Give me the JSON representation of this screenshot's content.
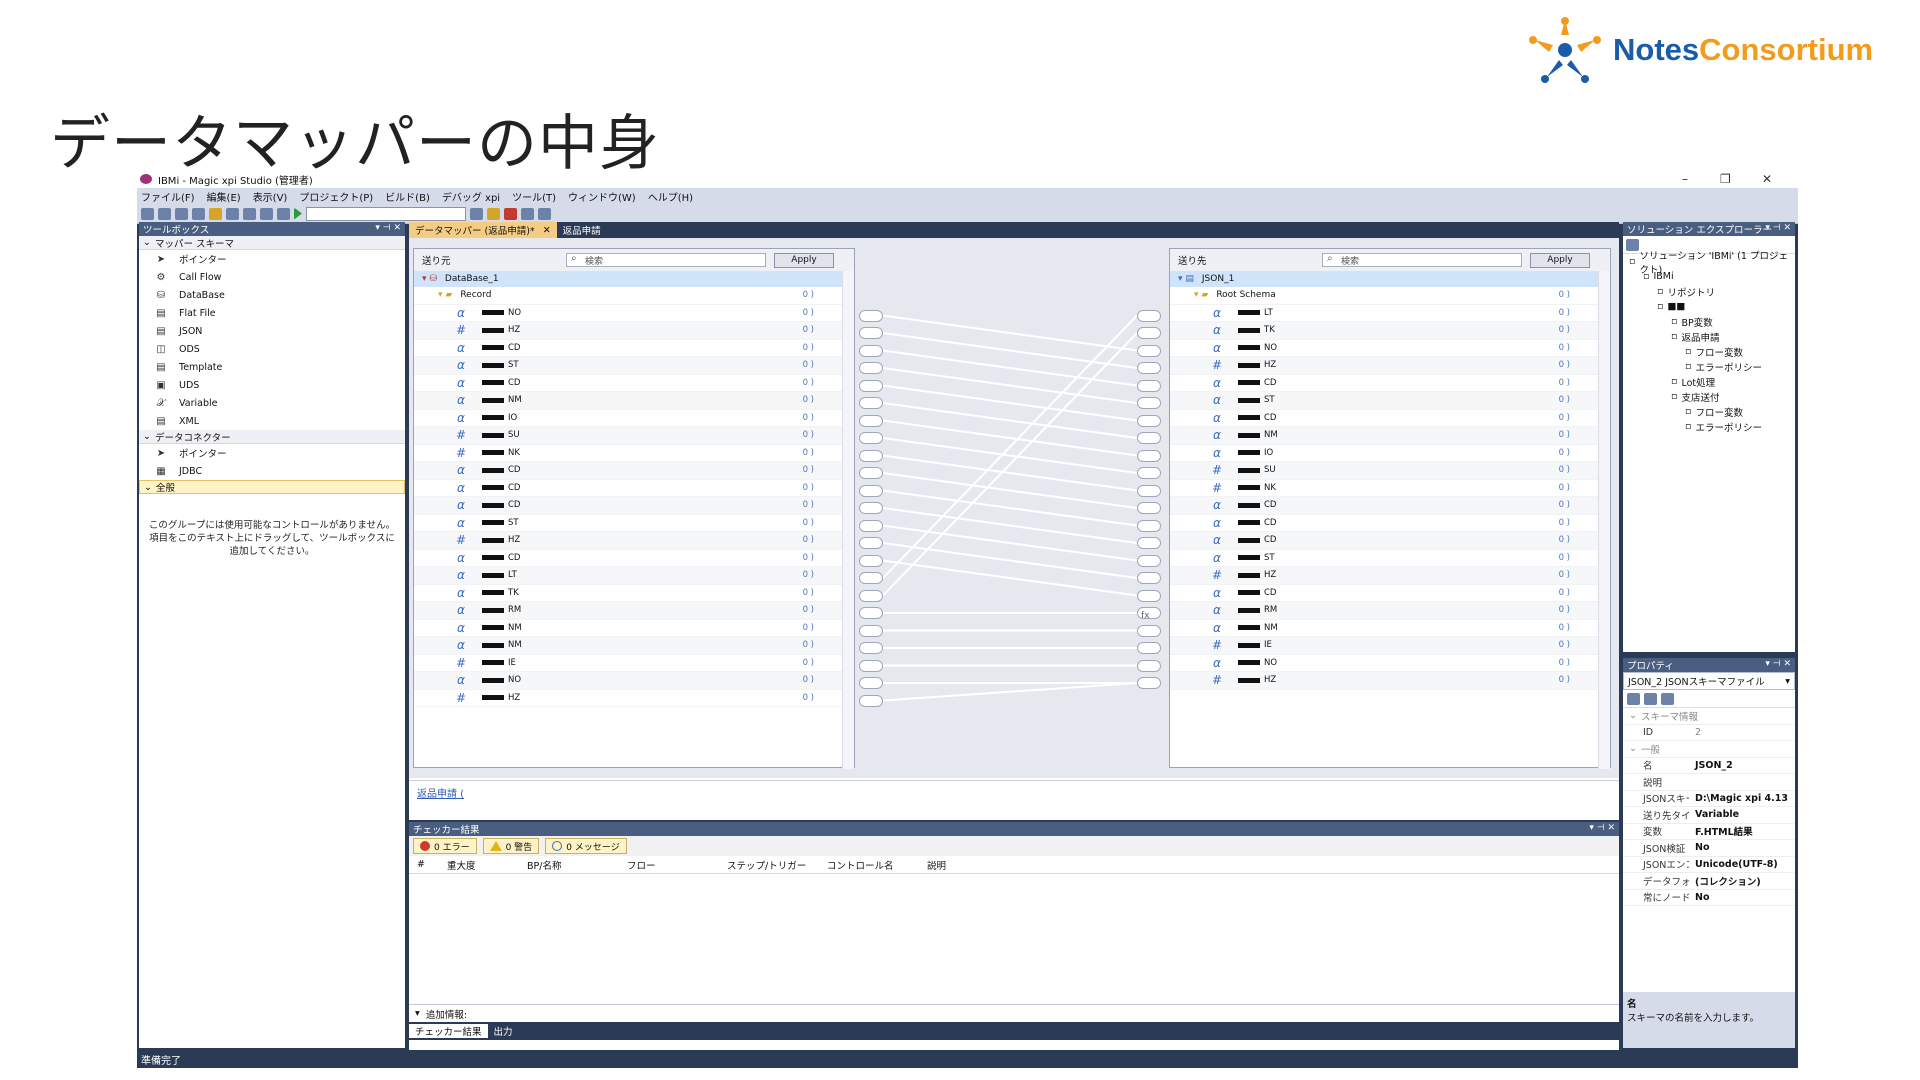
{
  "slide_title": "データマッパーの中身",
  "logo": {
    "part1": "Notes",
    "part2": "Consortium"
  },
  "window": {
    "title": "IBMi - Magic xpi Studio (管理者)",
    "minimize": "–",
    "restore": "❐",
    "close": "✕"
  },
  "menu": [
    "ファイル(F)",
    "編集(E)",
    "表示(V)",
    "プロジェクト(P)",
    "ビルド(B)",
    "デバッグ xpi",
    "ツール(T)",
    "ウィンドウ(W)",
    "ヘルプ(H)"
  ],
  "toolbox": {
    "title": "ツールボックス",
    "group1": "マッパー スキーマ",
    "group1_items": [
      {
        "icon": "➤",
        "label": "ポインター"
      },
      {
        "icon": "⚙",
        "label": "Call Flow"
      },
      {
        "icon": "⛁",
        "label": "DataBase"
      },
      {
        "icon": "▤",
        "label": "Flat File"
      },
      {
        "icon": "▤",
        "label": "JSON"
      },
      {
        "icon": "◫",
        "label": "ODS"
      },
      {
        "icon": "▤",
        "label": "Template"
      },
      {
        "icon": "▣",
        "label": "UDS"
      },
      {
        "icon": "𝒳",
        "label": "Variable"
      },
      {
        "icon": "▤",
        "label": "XML"
      }
    ],
    "group2": "データコネクター",
    "group2_items": [
      {
        "icon": "➤",
        "label": "ポインター"
      },
      {
        "icon": "▦",
        "label": "JDBC"
      }
    ],
    "group3": "全般",
    "note": "このグループには使用可能なコントロールがありません。項目をこのテキスト上にドラッグして、ツールボックスに追加してください。"
  },
  "doc_tabs": [
    {
      "label": "データマッパー (返品申請)*",
      "close": "✕"
    },
    {
      "label": "返品申請"
    }
  ],
  "source": {
    "title": "送り元",
    "search": "検索",
    "apply": "Apply",
    "root": "DataBase_1",
    "record": "Record",
    "rows": [
      {
        "t": "α",
        "n": "NO"
      },
      {
        "t": "#",
        "n": "HZ"
      },
      {
        "t": "α",
        "n": "CD"
      },
      {
        "t": "α",
        "n": "ST"
      },
      {
        "t": "α",
        "n": "CD"
      },
      {
        "t": "α",
        "n": "NM"
      },
      {
        "t": "α",
        "n": "IO"
      },
      {
        "t": "#",
        "n": "SU"
      },
      {
        "t": "#",
        "n": "NK"
      },
      {
        "t": "α",
        "n": "CD"
      },
      {
        "t": "α",
        "n": "CD"
      },
      {
        "t": "α",
        "n": "CD"
      },
      {
        "t": "α",
        "n": "ST"
      },
      {
        "t": "#",
        "n": "HZ"
      },
      {
        "t": "α",
        "n": "CD"
      },
      {
        "t": "α",
        "n": "LT"
      },
      {
        "t": "α",
        "n": "TK"
      },
      {
        "t": "α",
        "n": "RM"
      },
      {
        "t": "α",
        "n": "NM"
      },
      {
        "t": "α",
        "n": "NM"
      },
      {
        "t": "#",
        "n": "IE"
      },
      {
        "t": "α",
        "n": "NO"
      },
      {
        "t": "#",
        "n": "HZ"
      }
    ]
  },
  "target": {
    "title": "送り先",
    "search": "検索",
    "apply": "Apply",
    "root": "JSON_1",
    "record": "Root Schema",
    "rows": [
      {
        "t": "α",
        "n": "LT"
      },
      {
        "t": "α",
        "n": "TK"
      },
      {
        "t": "α",
        "n": "NO"
      },
      {
        "t": "#",
        "n": "HZ"
      },
      {
        "t": "α",
        "n": "CD"
      },
      {
        "t": "α",
        "n": "ST"
      },
      {
        "t": "α",
        "n": "CD"
      },
      {
        "t": "α",
        "n": "NM"
      },
      {
        "t": "α",
        "n": "IO"
      },
      {
        "t": "#",
        "n": "SU"
      },
      {
        "t": "#",
        "n": "NK"
      },
      {
        "t": "α",
        "n": "CD"
      },
      {
        "t": "α",
        "n": "CD"
      },
      {
        "t": "α",
        "n": "CD"
      },
      {
        "t": "α",
        "n": "ST"
      },
      {
        "t": "#",
        "n": "HZ"
      },
      {
        "t": "α",
        "n": "CD"
      },
      {
        "t": "α",
        "n": "RM"
      },
      {
        "t": "α",
        "n": "NM"
      },
      {
        "t": "#",
        "n": "IE"
      },
      {
        "t": "α",
        "n": "NO"
      },
      {
        "t": "#",
        "n": "HZ"
      }
    ]
  },
  "io_marker": "0 )",
  "fx_label": "fx",
  "editor_link": "返品申請 (",
  "checker": {
    "title": "チェッカー結果",
    "errors": "0 エラー",
    "warnings": "0 警告",
    "messages": "0 メッセージ",
    "columns": [
      "#",
      "重大度",
      "BP/名称",
      "フロー",
      "ステップ/トリガー",
      "コントロール名",
      "説明"
    ],
    "additional": "追加情報:",
    "tabs": [
      "チェッカー結果",
      "出力"
    ]
  },
  "solution": {
    "title": "ソリューション エクスプローラー",
    "items": [
      {
        "lvl": 0,
        "text": "ソリューション 'IBMi' (1 プロジェクト)"
      },
      {
        "lvl": 1,
        "text": "IBMi"
      },
      {
        "lvl": 2,
        "text": "リポジトリ"
      },
      {
        "lvl": 2,
        "text": "■■"
      },
      {
        "lvl": 3,
        "text": "BP変数"
      },
      {
        "lvl": 3,
        "text": "返品申請"
      },
      {
        "lvl": 4,
        "text": "フロー変数"
      },
      {
        "lvl": 4,
        "text": "エラーポリシー"
      },
      {
        "lvl": 3,
        "text": "Lot処理"
      },
      {
        "lvl": 3,
        "text": "支店送付"
      },
      {
        "lvl": 4,
        "text": "フロー変数"
      },
      {
        "lvl": 4,
        "text": "エラーポリシー"
      }
    ]
  },
  "properties": {
    "title": "プロパティ",
    "object": "JSON_2  JSONスキーマファイル",
    "section1": "スキーマ情報",
    "section2": "一般",
    "rows": [
      {
        "k": "ID",
        "v": "2",
        "dim": true
      },
      {
        "k": "名",
        "v": "JSON_2"
      },
      {
        "k": "説明",
        "v": ""
      },
      {
        "k": "JSONスキーマ",
        "v": "D:\\Magic xpi 4.13"
      },
      {
        "k": "送り先タイプ",
        "v": "Variable"
      },
      {
        "k": "変数",
        "v": "F.HTML結果"
      },
      {
        "k": "JSON検証",
        "v": "No"
      },
      {
        "k": "JSONエンコーデ",
        "v": "Unicode(UTF-8)"
      },
      {
        "k": "データフォーマット",
        "v": "(コレクション)"
      },
      {
        "k": "常にノードを作成",
        "v": "No"
      }
    ],
    "desc_title": "名",
    "desc_text": "スキーマの名前を入力します。"
  },
  "status": "準備完了"
}
